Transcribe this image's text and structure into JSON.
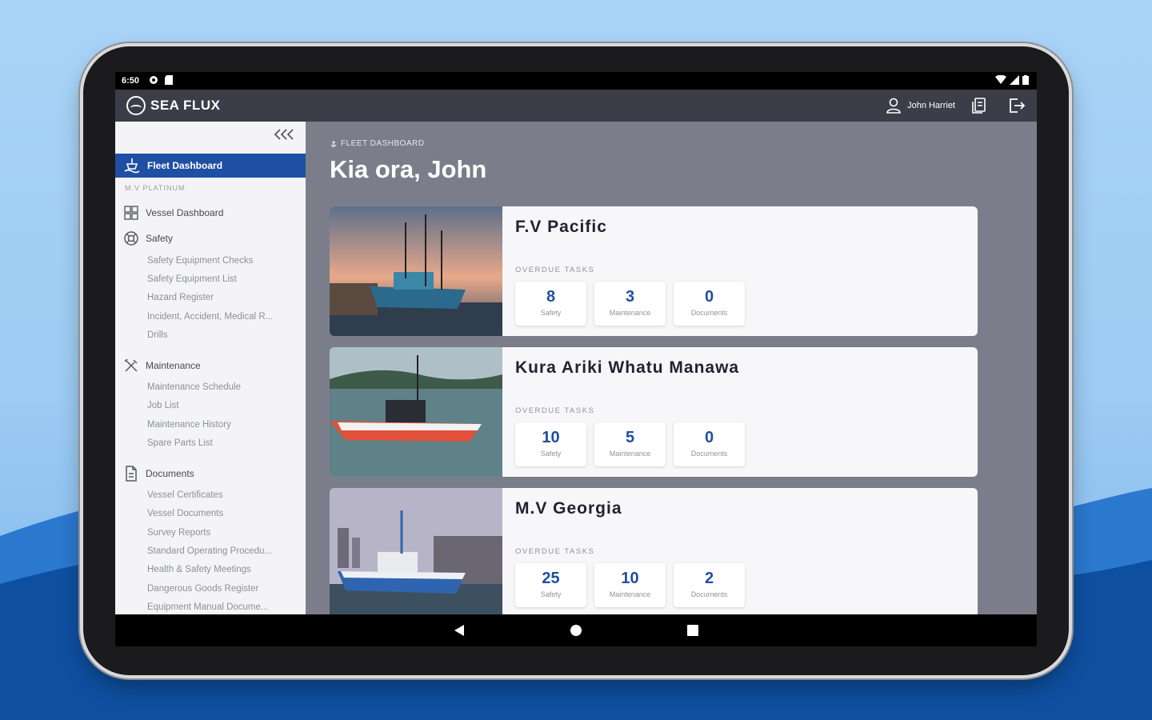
{
  "status_bar": {
    "time": "6:50"
  },
  "app_bar": {
    "brand": "SEA FLUX",
    "user_name": "John Harriet"
  },
  "sidebar": {
    "fleet_dashboard": "Fleet Dashboard",
    "vessel_label": "M.V PLATINUM",
    "vessel_dashboard": "Vessel Dashboard",
    "safety": {
      "label": "Safety",
      "items": [
        "Safety Equipment Checks",
        "Safety Equipment List",
        "Hazard Register",
        "Incident, Accident, Medical R...",
        "Drills"
      ]
    },
    "maintenance": {
      "label": "Maintenance",
      "items": [
        "Maintenance Schedule",
        "Job List",
        "Maintenance History",
        "Spare Parts List"
      ]
    },
    "documents": {
      "label": "Documents",
      "items": [
        "Vessel Certificates",
        "Vessel Documents",
        "Survey Reports",
        "Standard Operating Procedu...",
        "Health & Safety Meetings",
        "Dangerous Goods Register",
        "Equipment Manual Docume..."
      ]
    }
  },
  "main": {
    "breadcrumb": "FLEET DASHBOARD",
    "greeting": "Kia ora, John",
    "overdue_label": "OVERDUE TASKS",
    "task_labels": {
      "safety": "Safety",
      "maintenance": "Maintenance",
      "documents": "Documents"
    },
    "vessels": [
      {
        "name": "F.V Pacific",
        "safety": "8",
        "maintenance": "3",
        "documents": "0"
      },
      {
        "name": "Kura Ariki Whatu Manawa",
        "safety": "10",
        "maintenance": "5",
        "documents": "0"
      },
      {
        "name": "M.V Georgia",
        "safety": "25",
        "maintenance": "10",
        "documents": "2"
      }
    ]
  }
}
